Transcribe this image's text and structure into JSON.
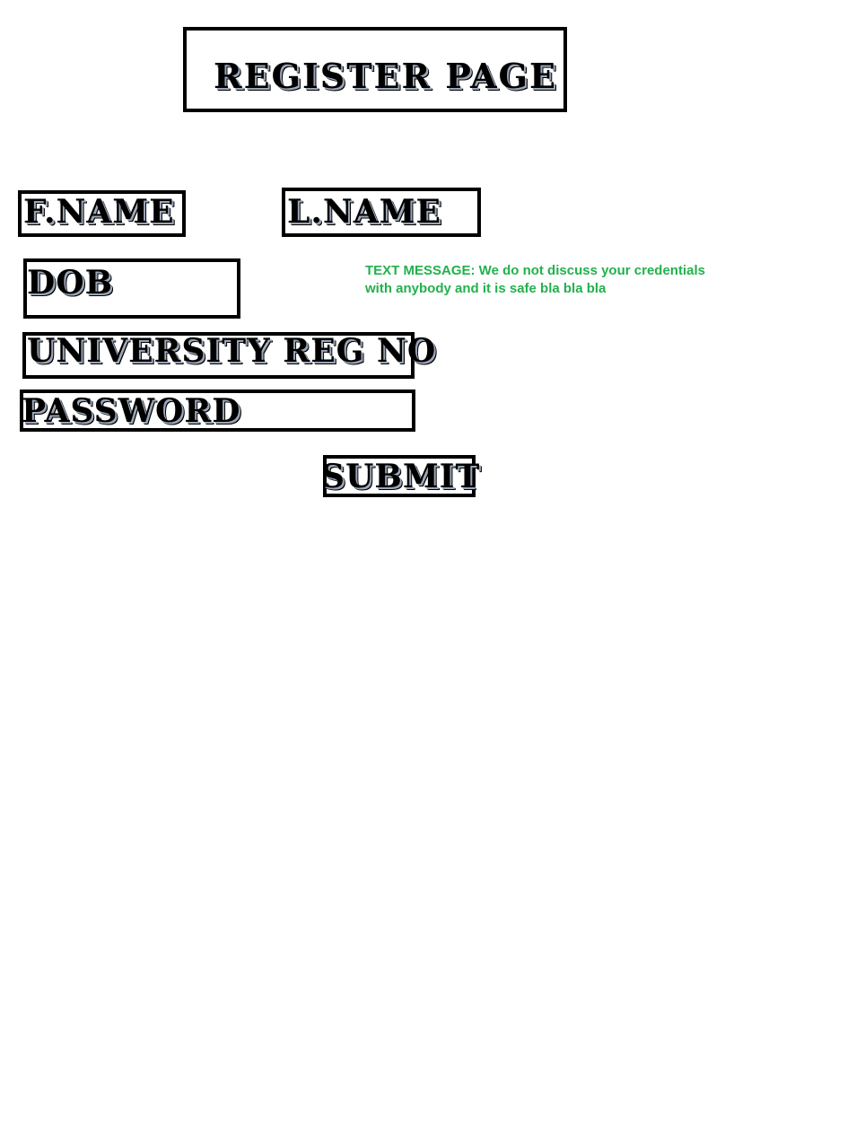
{
  "title": "REGISTER PAGE",
  "form": {
    "first_name_label": "F.NAME",
    "last_name_label": "L.NAME",
    "dob_label": "DOB",
    "reg_no_label": "UNIVERSITY REG NO",
    "password_label": "PASSWORD",
    "submit_label": "SUBMIT"
  },
  "note": "TEXT MESSAGE: We do not discuss your credentials with anybody and it is safe bla bla bla",
  "colors": {
    "border": "#000000",
    "note_text": "#22b14c",
    "background": "#ffffff"
  }
}
